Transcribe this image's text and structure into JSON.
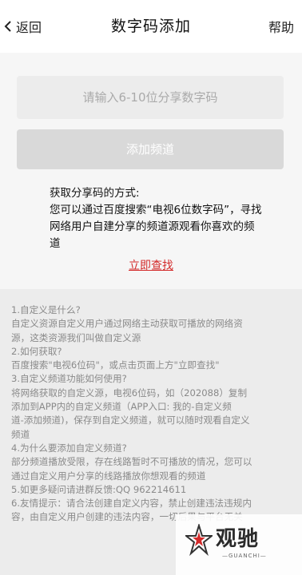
{
  "header": {
    "back_label": "返回",
    "title": "数字码添加",
    "help_label": "帮助"
  },
  "form": {
    "placeholder": "请输入6-10位分享数字码",
    "add_button_label": "添加频道"
  },
  "how": {
    "lines": [
      "获取分享码的方式:",
      "您可以通过百度搜索“电视6位数字码”，寻找",
      "网络用户自建分享的频道源观看你喜欢的频",
      "道"
    ],
    "find_link": "立即查找"
  },
  "faq": {
    "lines": [
      "1.自定义是什么?",
      "自定义资源自定义用户通过网络主动获取可播放的网络资",
      "源，这类资源我们叫做自定义源",
      "2.如何获取?",
      "百度搜索\"电视6位码\"，或点击页面上方\"立即查找\"",
      "3.自定义频道功能如何使用?",
      "将网络获取的自定义源，电视6位码，如（202088）复制",
      "添加到APP内的自定义频道（APP入口: 我的-自定义频",
      "道-添加频道)，保存到自定义频道，就可以随时观看自定义",
      "频道",
      "4.为什么要添加自定义频道?",
      "部分频道播放受限，存在线路暂时不可播放的情况，您可以",
      "通过自定义用户分享的线路播放你想观看的频道",
      "5.如更多疑问请进群反馈:QQ 962214611",
      "6.友情提示：请合法创建自定义内容，禁止创建违法违规内",
      "容，由自定义用户创建的违法内容，一切后果与平台无关"
    ]
  },
  "watermark": {
    "name_cn": "观驰",
    "name_en": "—GUANCHI—"
  }
}
